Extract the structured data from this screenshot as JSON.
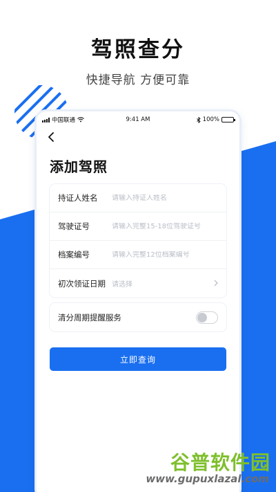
{
  "promo": {
    "title": "驾照查分",
    "subtitle": "快捷导航 方便可靠",
    "accent_color": "#1a6ff0"
  },
  "status_bar": {
    "carrier": "中国联通",
    "time": "9:41 AM",
    "battery": "100%",
    "icons": [
      "signal-icon",
      "wifi-icon",
      "bluetooth-icon",
      "battery-icon"
    ]
  },
  "nav": {
    "back_icon": "chevron-left-icon"
  },
  "page": {
    "title": "添加驾照"
  },
  "form": {
    "fields": [
      {
        "label": "持证人姓名",
        "placeholder": "请输入持证人姓名",
        "value": ""
      },
      {
        "label": "驾驶证号",
        "placeholder": "请输入完整15-18位驾驶证号",
        "value": ""
      },
      {
        "label": "档案编号",
        "placeholder": "请输入完整12位档案编号",
        "value": ""
      }
    ],
    "date_field": {
      "label": "初次领证日期",
      "placeholder": "请选择",
      "icon": "chevron-right-icon"
    }
  },
  "toggle": {
    "label": "清分周期提醒服务",
    "on": false
  },
  "submit": {
    "label": "立即查询"
  },
  "watermark": {
    "title": "谷普软件园",
    "url": "www.gupuxlazal.com"
  }
}
